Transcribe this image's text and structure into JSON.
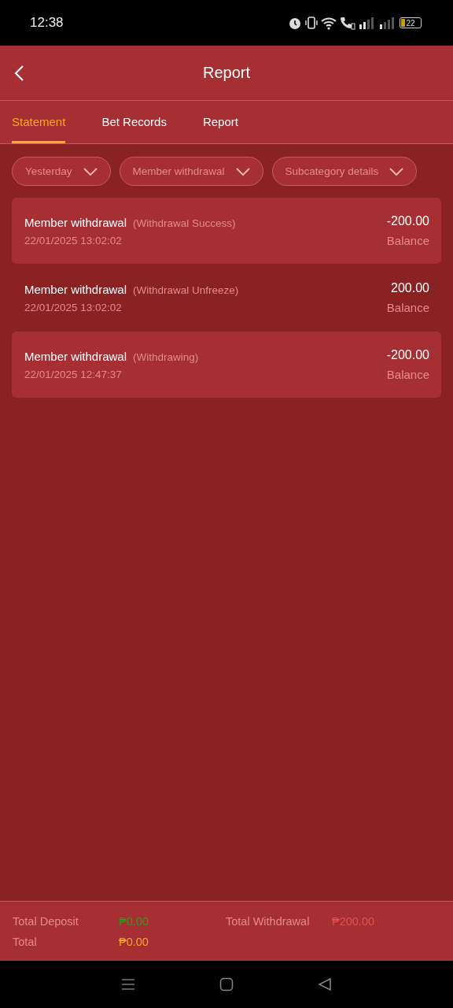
{
  "status_bar": {
    "time": "12:38",
    "battery": "22"
  },
  "header": {
    "title": "Report"
  },
  "tabs": [
    {
      "label": "Statement",
      "selected": true
    },
    {
      "label": "Bet Records",
      "selected": false
    },
    {
      "label": "Report",
      "selected": false
    }
  ],
  "filters": [
    {
      "label": "Yesterday"
    },
    {
      "label": "Member withdrawal"
    },
    {
      "label": "Subcategory details"
    }
  ],
  "records": [
    {
      "type": "Member withdrawal",
      "status": "(Withdrawal Success)",
      "time": "22/01/2025 13:02:02",
      "amount": "-200.00",
      "account": "Balance"
    },
    {
      "type": "Member withdrawal",
      "status": "(Withdrawal Unfreeze)",
      "time": "22/01/2025 13:02:02",
      "amount": "200.00",
      "account": "Balance"
    },
    {
      "type": "Member withdrawal",
      "status": "(Withdrawing)",
      "time": "22/01/2025 12:47:37",
      "amount": "-200.00",
      "account": "Balance"
    }
  ],
  "summary": [
    {
      "label": "Total Deposit",
      "value": "₱0.00",
      "color": "#2e9a1e"
    },
    {
      "label": "Total Withdrawal",
      "value": "₱200.00",
      "color": "#e2504f"
    },
    {
      "label": "Total",
      "value": "₱0.00",
      "color": "#f5a623"
    }
  ]
}
